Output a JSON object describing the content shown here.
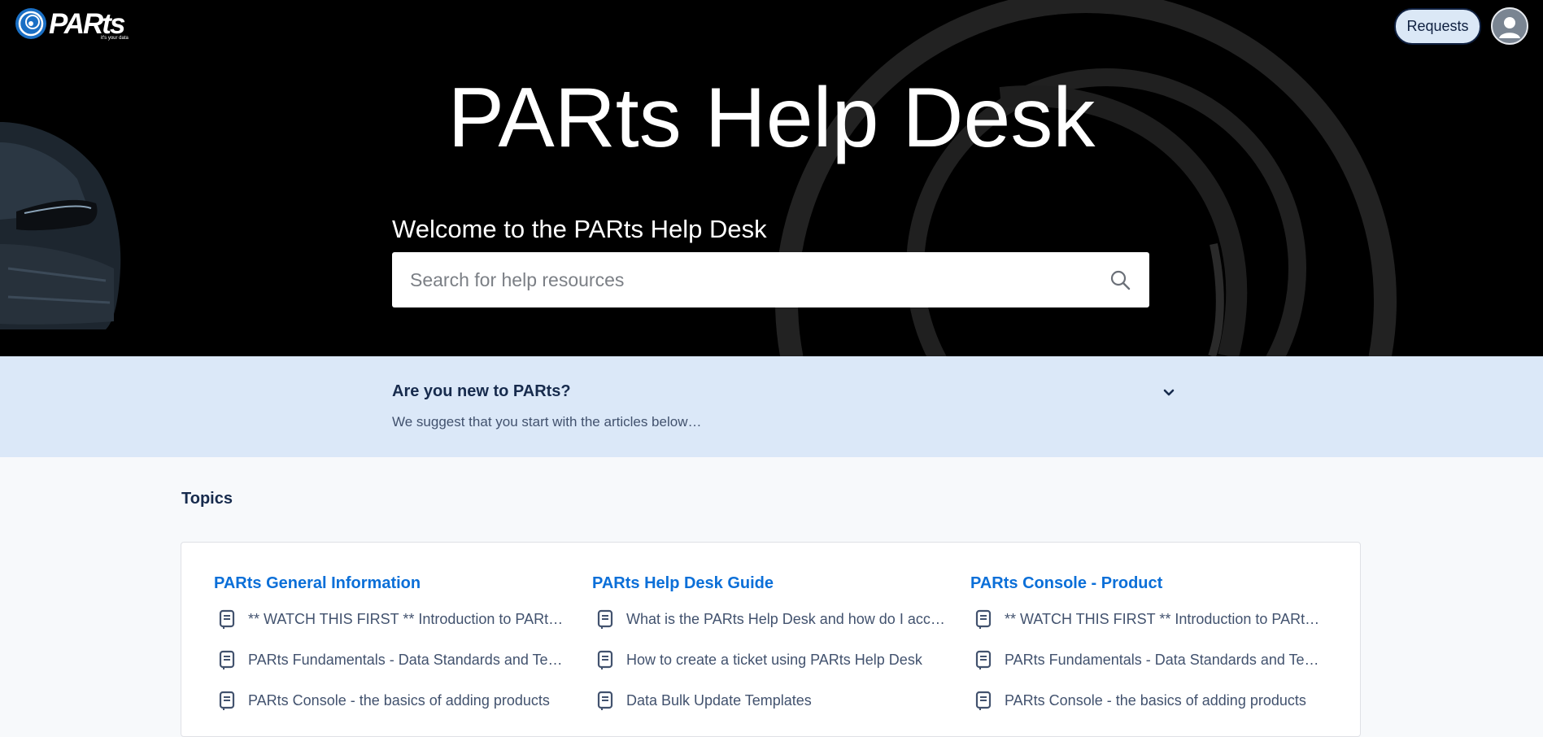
{
  "header": {
    "logo_text": "PARts",
    "logo_tagline": "it's your data",
    "requests_label": "Requests"
  },
  "hero": {
    "title": "PARts Help Desk",
    "welcome": "Welcome to the PARts Help Desk",
    "search_placeholder": "Search for help resources"
  },
  "banner": {
    "title": "Are you new to PARts?",
    "subtitle": "We suggest that you start with the articles below…"
  },
  "topics": {
    "heading": "Topics",
    "columns": [
      {
        "title": "PARts General Information",
        "articles": [
          "** WATCH THIS FIRST ** Introduction to PARts…",
          "PARts Fundamentals - Data Standards and Ter…",
          "PARts Console - the basics of adding products"
        ]
      },
      {
        "title": "PARts Help Desk Guide",
        "articles": [
          "What is the PARts Help Desk and how do I acc…",
          "How to create a ticket using PARts Help Desk",
          "Data Bulk Update Templates"
        ]
      },
      {
        "title": "PARts Console - Product",
        "articles": [
          "** WATCH THIS FIRST ** Introduction to PARts…",
          "PARts Fundamentals - Data Standards and Ter…",
          "PARts Console - the basics of adding products"
        ]
      }
    ]
  },
  "colors": {
    "hero_bg": "#000000",
    "banner_bg": "#dbe8f8",
    "link": "#0b6fd8",
    "requests_bg": "#dbe8f6"
  },
  "icons": {
    "logo": "parts-swirl-logo-icon",
    "search": "search-icon",
    "chevron": "chevron-down-icon",
    "article": "document-icon",
    "avatar": "user-avatar-icon"
  }
}
